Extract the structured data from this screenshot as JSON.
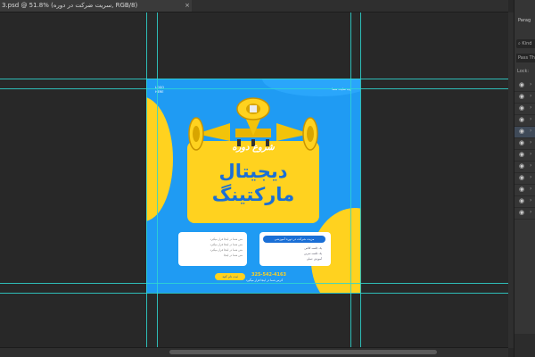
{
  "document": {
    "tab_title": "3.psd @ 51.8% (سریت ضرکت در دوره, RGB/8)"
  },
  "poster": {
    "logo_text": "LOGO HERE",
    "top_contact": "وب سایت شما",
    "course_start": "شروع دوره",
    "title_line1": "دیجیتال",
    "title_line2": "مارکتینگ",
    "right_card": {
      "header": "مزیت شرکت در دوره آموزشی",
      "lines": [
        "یک جلسه کلاس",
        "یک جلسه تمرین",
        "آموزش عملی"
      ]
    },
    "left_card": {
      "lines": [
        "متن شما در اینجا قرار میگیرد",
        "متن شما در اینجا قرار میگیرد",
        "متن شما در اینجا قرار میگیرد",
        "متن شما در اینجا"
      ]
    },
    "phone": "325-542-4163",
    "address": "آدرس شما در اینجا قرار میگیرد",
    "cta": "ثبت نام کنید"
  },
  "panel": {
    "tab_label": "Parag",
    "search_value": "Kind",
    "blend_mode": "Pass Th",
    "lock_label": "Lock:"
  },
  "icons": {
    "eye": "eye-icon",
    "megaphone": "megaphone-icon"
  },
  "colors": {
    "canvas_bg": "#282828",
    "poster_blue": "#1f9bf3",
    "poster_yellow": "#ffd21f",
    "title_blue": "#1a6fd6",
    "guide": "#2fd6d0"
  }
}
